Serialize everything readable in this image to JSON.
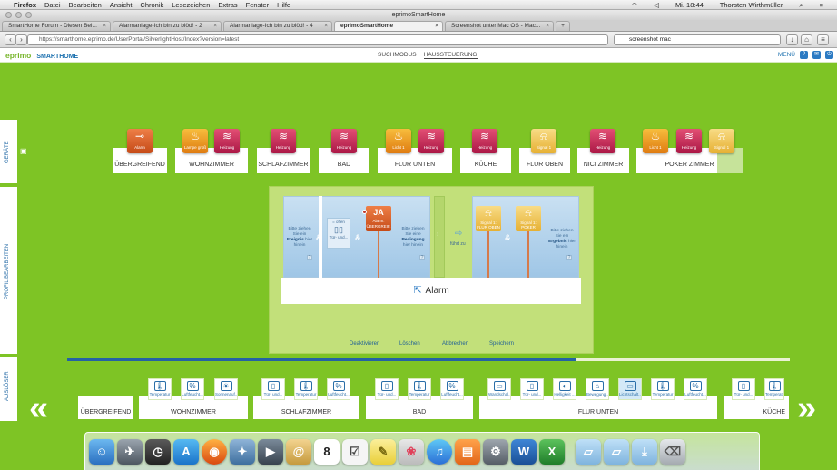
{
  "menubar": {
    "app": "Firefox",
    "items": [
      "Datei",
      "Bearbeiten",
      "Ansicht",
      "Chronik",
      "Lesezeichen",
      "Extras",
      "Fenster",
      "Hilfe"
    ],
    "clock": "Mi. 18:44",
    "user": "Thorsten Wirthmüller"
  },
  "window": {
    "title": "eprimoSmartHome"
  },
  "tabs": [
    {
      "label": "SmartHome Forum - Diesen Bei..."
    },
    {
      "label": "Alarmanlage-Ich bin zu blöd! - 2"
    },
    {
      "label": "Alarmanlage-Ich bin zu blöd! - 4"
    },
    {
      "label": "eprimoSmartHome",
      "active": true
    },
    {
      "label": "Screenshot unter Mac OS - Mac..."
    }
  ],
  "navbar": {
    "url": "https://smarthome.eprimo.de/UserPortal/SilverlightHost/Index?version=latest",
    "search_value": "screenshot mac"
  },
  "header": {
    "logo": "eprimo",
    "product": "SMARTHOME",
    "nav": [
      "SUCHMODUS",
      "HAUSSTEUERUNG"
    ],
    "menu": "MENÜ"
  },
  "sidebar": {
    "tabs": [
      "GERÄTE",
      "PROFIL BEARBEITEN",
      "AUSLÖSER"
    ]
  },
  "rooms": [
    "ÜBERGREIFEND",
    "WOHNZIMMER",
    "SCHLAFZIMMER",
    "BAD",
    "FLUR UNTEN",
    "KÜCHE",
    "FLUR OBEN",
    "NICI ZIMMER",
    "POKER ZIMMER"
  ],
  "devices": [
    {
      "label": "Alarm",
      "kind": "alarm",
      "icon": "alarm-icon"
    },
    {
      "label": "Lampe groß",
      "kind": "lamp",
      "icon": "lamp-icon"
    },
    {
      "label": "Heizung",
      "kind": "heat",
      "icon": "heating-icon"
    },
    {
      "label": "Heizung",
      "kind": "heat",
      "icon": "heating-icon"
    },
    {
      "label": "Heizung",
      "kind": "heat",
      "icon": "heating-icon"
    },
    {
      "label": "Licht 1",
      "kind": "lamp",
      "icon": "lamp-icon"
    },
    {
      "label": "Heizung",
      "kind": "heat",
      "icon": "heating-icon"
    },
    {
      "label": "Heizung",
      "kind": "heat",
      "icon": "heating-icon"
    },
    {
      "label": "Signal 1",
      "kind": "sig",
      "icon": "bell-icon"
    },
    {
      "label": "Heizung",
      "kind": "heat",
      "icon": "heating-icon"
    },
    {
      "label": "Licht 1",
      "kind": "lamp",
      "icon": "lamp-icon"
    },
    {
      "label": "Heizung",
      "kind": "heat",
      "icon": "heating-icon"
    },
    {
      "label": "Signal 1",
      "kind": "sig",
      "icon": "bell-icon"
    }
  ],
  "editor": {
    "hint_event_pre": "Bitte ziehen Sie ein",
    "hint_event_bold": "Ereignis",
    "hint_event_post": "hier hinein",
    "amp": "&",
    "door_state": "= offen",
    "door_label": "Tür- und...",
    "ja_badge": "JA",
    "alarm_card": "Alarm: ÜBERGREIF.",
    "hint_cond_pre": "Bitte ziehen Sie eine",
    "hint_cond_bold": "Bedingung",
    "hint_cond_post": "hier hinein",
    "fuehrt_zu": "führt zu",
    "signal_flur": "Signal 1: FLUR OBEN",
    "signal_poker": "Signal 1: POKER",
    "hint_result_pre": "Bitte ziehen Sie ein",
    "hint_result_bold": "Ergebnis",
    "hint_result_post": "hier hinein",
    "profile_name": "Alarm",
    "actions": [
      "Deaktivieren",
      "Löschen",
      "Abbrechen",
      "Speichern"
    ]
  },
  "trigger_rooms": [
    "ÜBERGREIFEND",
    "WOHNZIMMER",
    "SCHLAFZIMMER",
    "BAD",
    "FLUR UNTEN",
    "KÜCHE"
  ],
  "sensors": [
    {
      "label": "Temperatur",
      "glyph": "🌡"
    },
    {
      "label": "Luftfeucht...",
      "glyph": "%"
    },
    {
      "label": "Sonnenauf...",
      "glyph": "☀"
    },
    {
      "label": "Tür- und...",
      "glyph": "▯"
    },
    {
      "label": "Temperatur",
      "glyph": "🌡"
    },
    {
      "label": "Luftfeucht...",
      "glyph": "%"
    },
    {
      "label": "Tür- und...",
      "glyph": "▯"
    },
    {
      "label": "Temperatur",
      "glyph": "🌡"
    },
    {
      "label": "Luftfeucht...",
      "glyph": "%"
    },
    {
      "label": "Wandschal...",
      "glyph": "▭"
    },
    {
      "label": "Tür- und...",
      "glyph": "▯"
    },
    {
      "label": "Helligkeit ...",
      "glyph": "◐"
    },
    {
      "label": "Bewegung...",
      "glyph": "⌂"
    },
    {
      "label": "Lichtschalt...",
      "glyph": "▭"
    },
    {
      "label": "Temperatur",
      "glyph": "🌡"
    },
    {
      "label": "Luftfeucht...",
      "glyph": "%"
    },
    {
      "label": "Tür- und...",
      "glyph": "▯"
    },
    {
      "label": "Temperatur",
      "glyph": "🌡"
    }
  ],
  "nav_arrows": {
    "left": "«",
    "right": "»"
  },
  "dock": [
    "Finder",
    "Launchpad",
    "Dashboard",
    "App Store",
    "Firefox",
    "Preview",
    "FaceTime",
    "Mail",
    "Calendar",
    "Reminders",
    "Notes",
    "Photos",
    "iTunes",
    "iBooks",
    "System Preferences",
    "Word",
    "Excel",
    "Folder",
    "Documents",
    "Downloads",
    "Trash"
  ]
}
